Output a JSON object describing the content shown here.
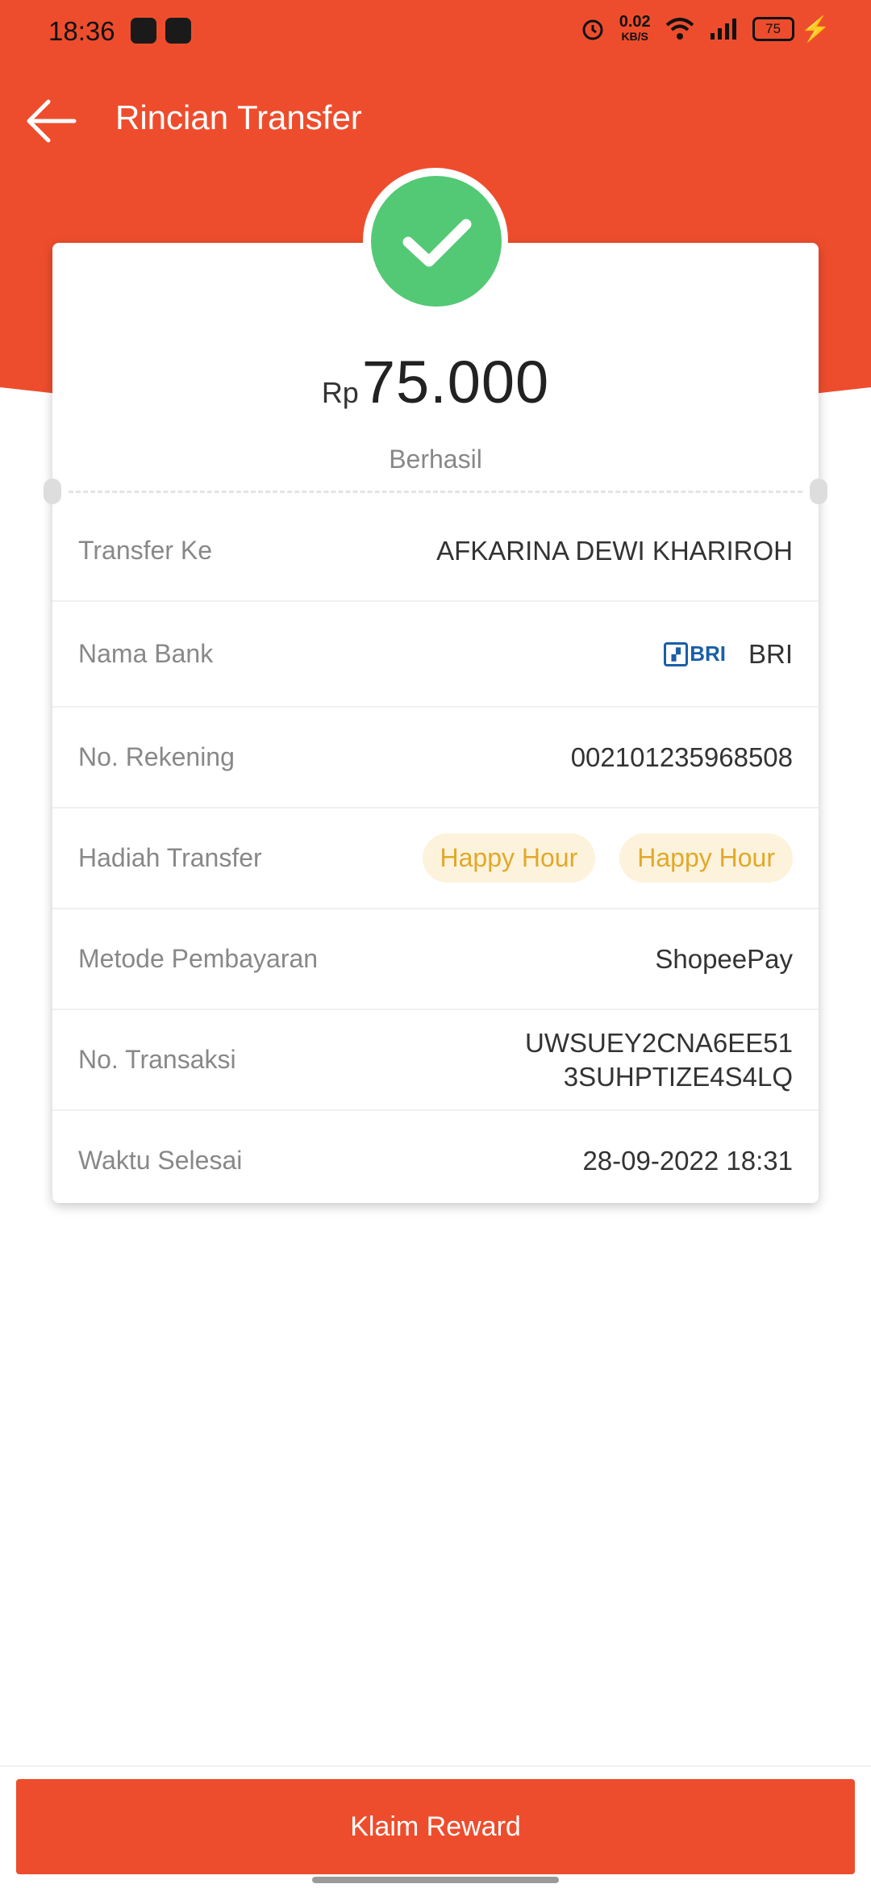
{
  "status_bar": {
    "time": "18:36",
    "net_speed_value": "0.02",
    "net_speed_unit": "KB/S",
    "battery": "75"
  },
  "header": {
    "title": "Rincian Transfer"
  },
  "summary": {
    "currency": "Rp",
    "amount": "75.000",
    "status": "Berhasil"
  },
  "details": {
    "transfer_to": {
      "label": "Transfer Ke",
      "value": "AFKARINA DEWI KHARIROH"
    },
    "bank_name": {
      "label": "Nama Bank",
      "logo_text": "BRI",
      "value": "BRI"
    },
    "account_number": {
      "label": "No. Rekening",
      "value": "002101235968508"
    },
    "transfer_reward": {
      "label": "Hadiah Transfer",
      "chips": [
        "Happy Hour",
        "Happy Hour"
      ]
    },
    "payment_method": {
      "label": "Metode Pembayaran",
      "value": "ShopeePay"
    },
    "transaction_no": {
      "label": "No. Transaksi",
      "line1": "UWSUEY2CNA6EE51",
      "line2": "3SUHPTIZE4S4LQ"
    },
    "completed_time": {
      "label": "Waktu Selesai",
      "value": "28-09-2022 18:31"
    }
  },
  "footer": {
    "claim_button": "Klaim Reward"
  },
  "colors": {
    "brand": "#ee4d2d",
    "success": "#53c975",
    "chip_bg": "#fdf3dc",
    "chip_text": "#e2a829"
  }
}
